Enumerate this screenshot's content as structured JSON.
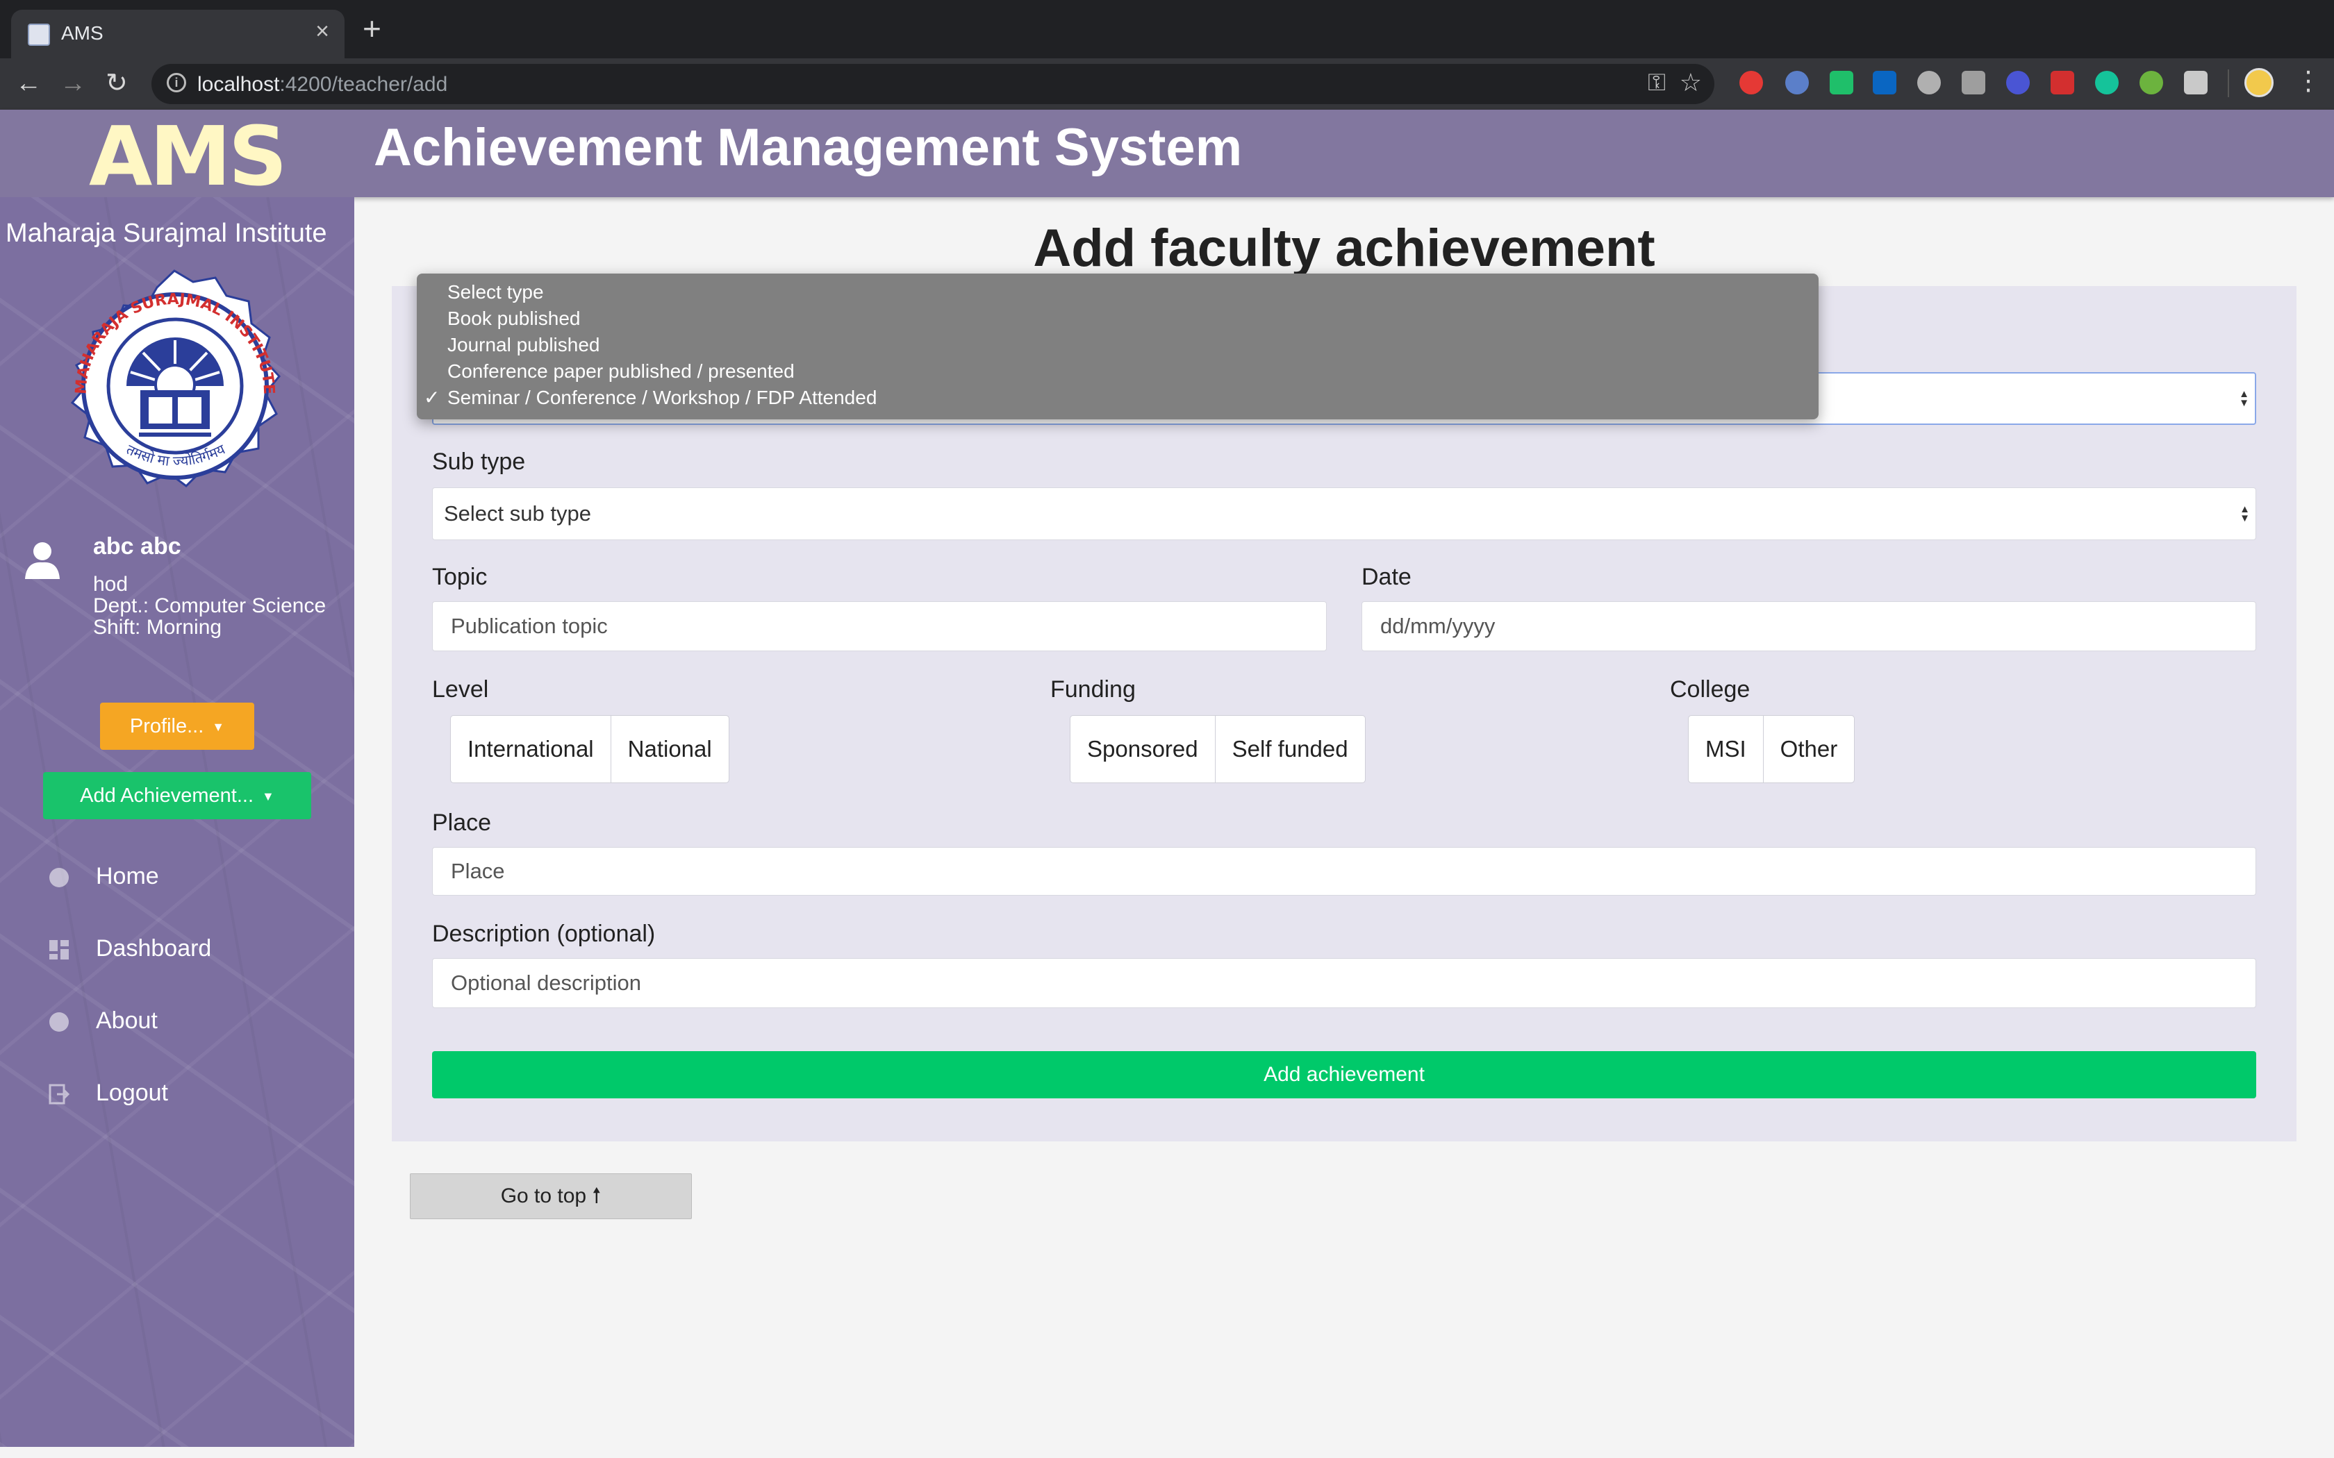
{
  "browser": {
    "tab_title": "AMS",
    "tab_close": "×",
    "new_tab": "+",
    "url_host": "localhost",
    "url_path": ":4200/teacher/add",
    "back": "←",
    "forward": "→",
    "reload": "↻",
    "key_icon": "⚿",
    "star_icon": "☆",
    "menu": "⋮"
  },
  "header": {
    "logo": "AMS",
    "title": "Achievement Management System"
  },
  "sidebar": {
    "institute": "Maharaja Surajmal Institute",
    "crest_top": "MAHARAJA SURAJMAL INSTITUTE",
    "crest_bottom": "तमसो मा ज्योतिर्गमय",
    "user": {
      "name": "abc abc",
      "role": "hod",
      "dept": "Dept.: Computer Science",
      "shift": "Shift: Morning"
    },
    "profile_button": "Profile...",
    "add_button": "Add Achievement...",
    "caret": "▼",
    "nav": [
      {
        "label": "Home",
        "icon": "home-icon"
      },
      {
        "label": "Dashboard",
        "icon": "dashboard-icon"
      },
      {
        "label": "About",
        "icon": "info-icon"
      },
      {
        "label": "Logout",
        "icon": "logout-icon"
      }
    ]
  },
  "main": {
    "title": "Add faculty achievement",
    "type_dropdown": {
      "options": [
        "Select type",
        "Book published",
        "Journal published",
        "Conference paper published / presented",
        "Seminar / Conference / Workshop / FDP Attended"
      ],
      "selected_index": 4,
      "checkmark": "✓"
    },
    "subtype": {
      "label": "Sub type",
      "value": "Select sub type"
    },
    "topic": {
      "label": "Topic",
      "placeholder": "Publication topic"
    },
    "date": {
      "label": "Date",
      "placeholder": "dd/mm/yyyy"
    },
    "level": {
      "label": "Level",
      "options": [
        "International",
        "National"
      ]
    },
    "funding": {
      "label": "Funding",
      "options": [
        "Sponsored",
        "Self funded"
      ]
    },
    "college": {
      "label": "College",
      "options": [
        "MSI",
        "Other"
      ]
    },
    "place": {
      "label": "Place",
      "placeholder": "Place"
    },
    "description": {
      "label": "Description (optional)",
      "placeholder": "Optional description"
    },
    "submit": "Add achievement",
    "go_top": "Go to top 🠕"
  },
  "colors": {
    "header": "#82779f",
    "sidebar": "#7c6fa0",
    "logo": "#fff7c4",
    "profile_btn": "#f5a623",
    "add_btn": "#19c36b",
    "submit": "#00c96a",
    "card": "#e6e4ef"
  }
}
